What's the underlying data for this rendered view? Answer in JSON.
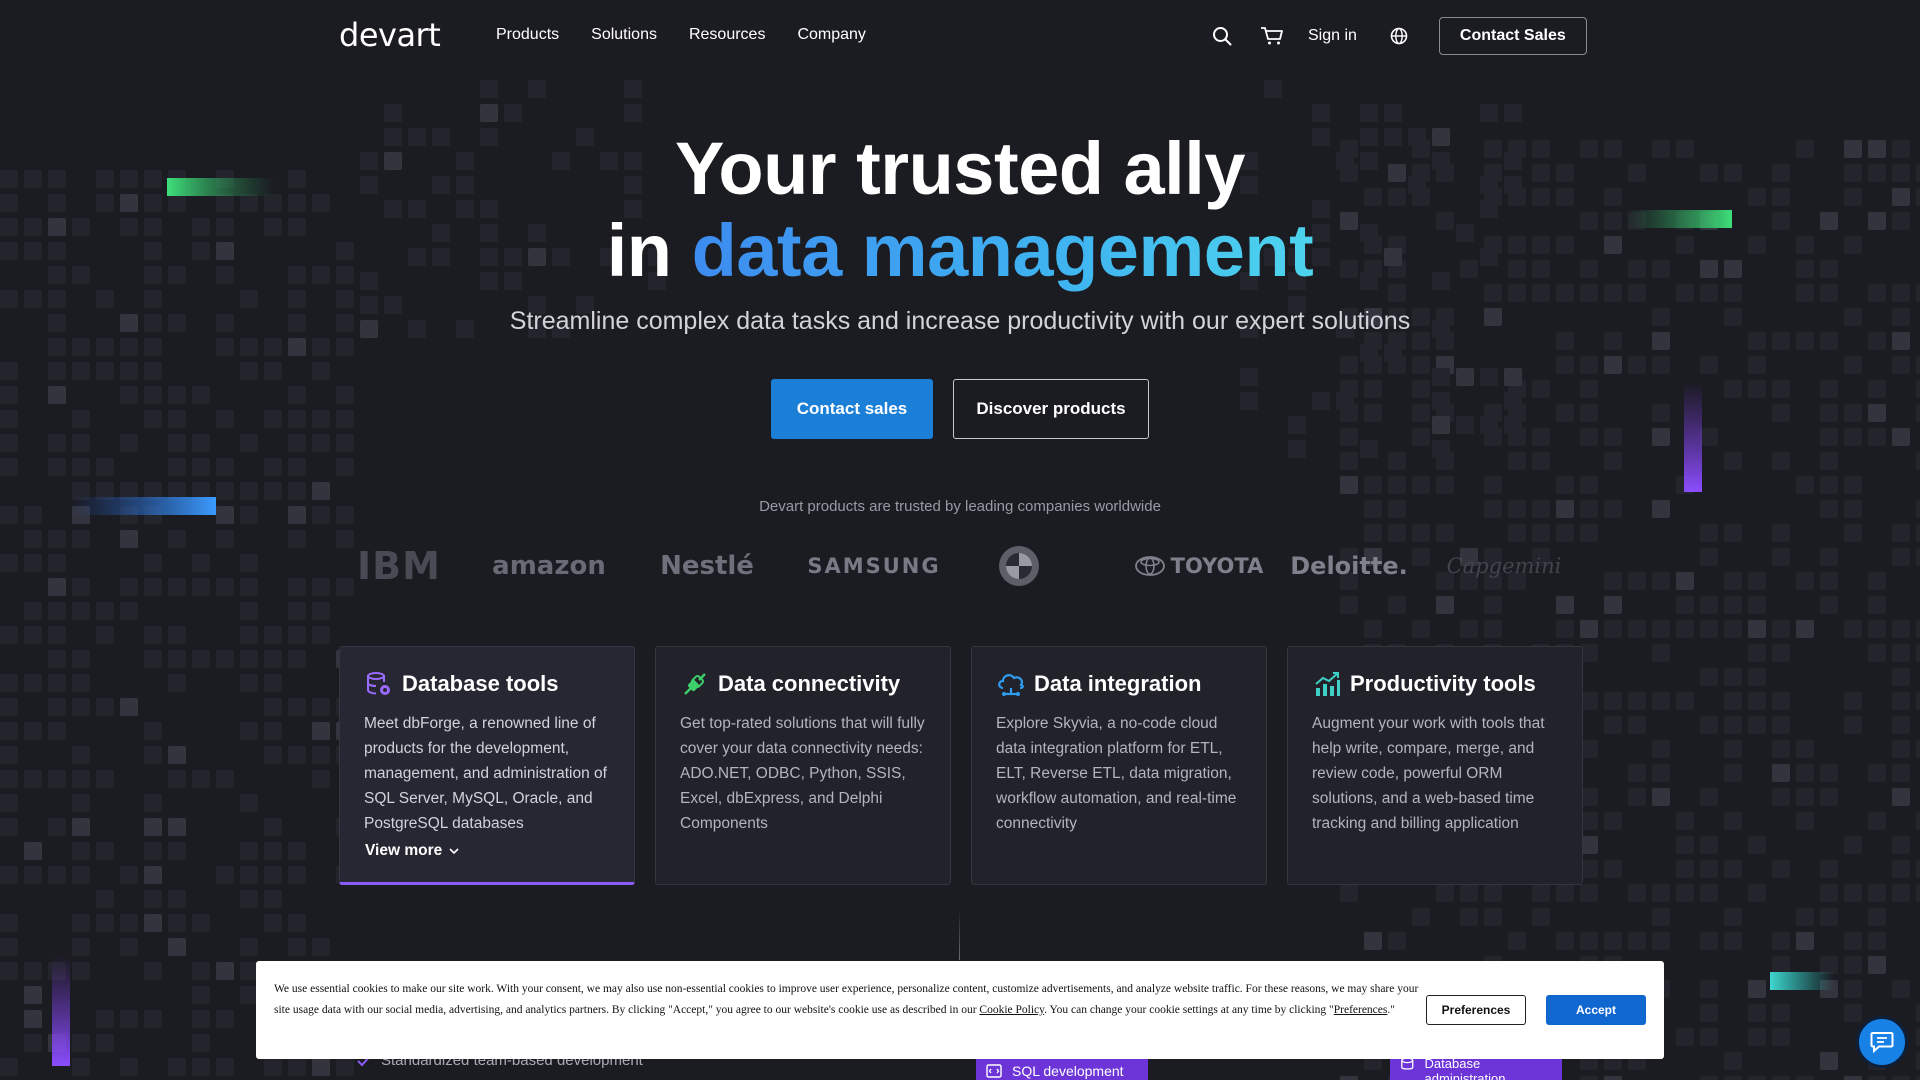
{
  "brand": {
    "logo_text": "devart"
  },
  "nav": {
    "menu": [
      "Products",
      "Solutions",
      "Resources",
      "Company"
    ],
    "signin": "Sign in",
    "contact": "Contact Sales",
    "icons": [
      "search-icon",
      "cart-icon",
      "globe-icon"
    ]
  },
  "hero": {
    "line1": "Your trusted ally",
    "line2_plain": "in",
    "line2_accent": "data management",
    "subtitle": "Streamline complex data tasks and increase productivity with our expert solutions",
    "primary_btn": "Contact sales",
    "secondary_btn": "Discover products",
    "accent_colors": [
      "#3d8cf0",
      "#4ed4ee"
    ]
  },
  "trusted": {
    "caption": "Devart products are trusted by leading companies worldwide",
    "logos": [
      "IBM",
      "amazon",
      "Nestlé",
      "SAMSUNG",
      "BMW",
      "TOYOTA",
      "Deloitte.",
      "Capgemini"
    ]
  },
  "cards": [
    {
      "title": "Database tools",
      "icon": "database-gear-icon",
      "desc": "Meet dbForge, a renowned line of products for the development, management, and administration of SQL Server, MySQL, Oracle, and PostgreSQL databases",
      "more": "View more"
    },
    {
      "title": "Data connectivity",
      "icon": "connectivity-icon",
      "desc": "Get top-rated solutions that will fully cover your data connectivity needs: ADO.NET, ODBC, Python, SSIS, Excel, dbExpress, and Delphi Components"
    },
    {
      "title": "Data integration",
      "icon": "cloud-integration-icon",
      "desc": "Explore Skyvia, a no-code cloud data integration platform for ETL, ELT, Reverse ETL, data migration, workflow automation, and real-time connectivity"
    },
    {
      "title": "Productivity tools",
      "icon": "chart-growth-icon",
      "desc": "Augment your work with tools that help write, compare, merge, and review code, powerful ORM solutions, and a web-based time tracking and billing application"
    }
  ],
  "peek": {
    "check_item": "Standardized team-based development",
    "chip1": "SQL development",
    "chip2": "Database administration"
  },
  "cookie": {
    "text_1": "We use essential cookies to make our site work. With your consent, we may also use non-essential cookies to improve user experience, personalize content, customize advertisements, and analyze website traffic. For these reasons, we may share your site usage data with our social media, advertising, and analytics partners. By clicking \"Accept,\" you agree to our website's cookie use as described in our ",
    "link_policy": "Cookie Policy",
    "text_2": ". You can change your cookie settings at any time by clicking \"",
    "link_pref": "Preferences",
    "text_3": ".\"",
    "preferences_btn": "Preferences",
    "accept_btn": "Accept"
  }
}
